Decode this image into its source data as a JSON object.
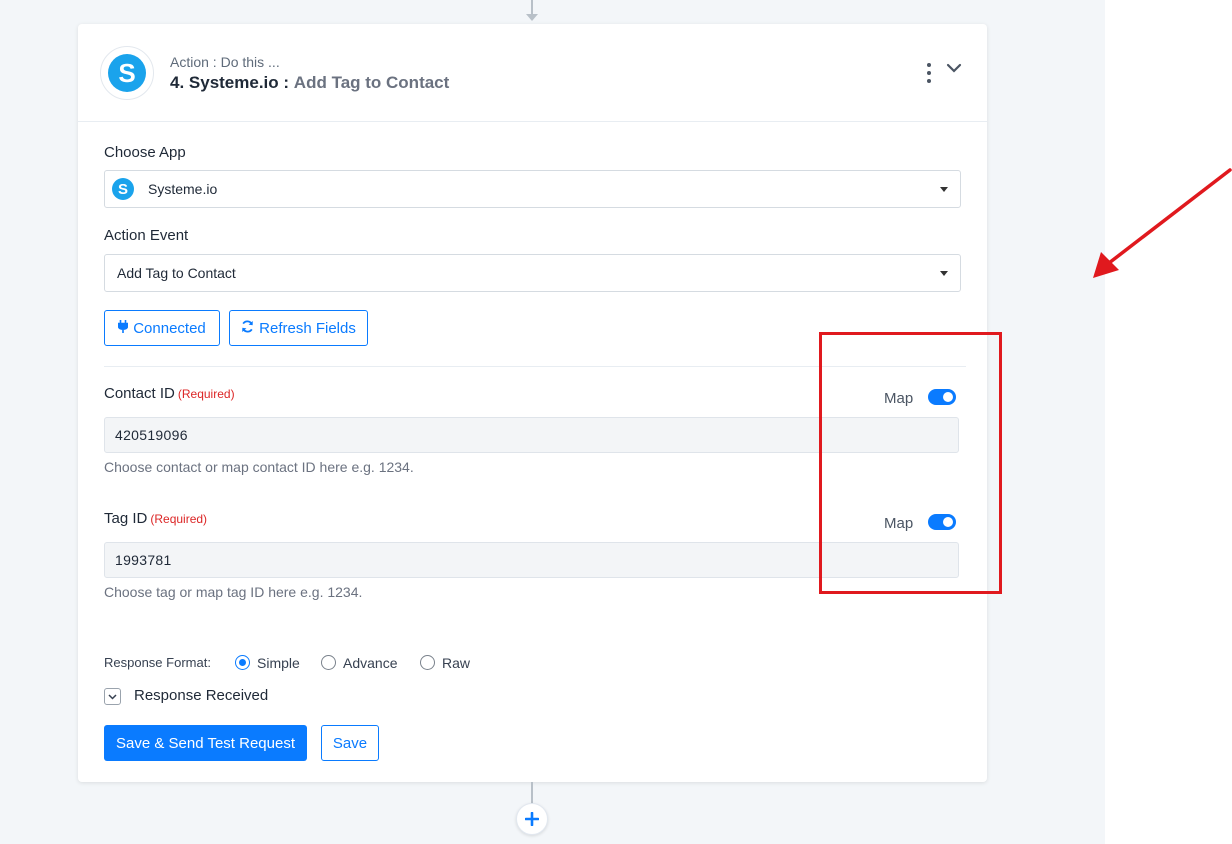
{
  "step": {
    "kicker": "Action : Do this ...",
    "number_app": "4. Systeme.io :",
    "event": "Add Tag to Contact",
    "logo_letter": "S"
  },
  "choose_app": {
    "label": "Choose App",
    "value": "Systeme.io"
  },
  "action_event": {
    "label": "Action Event",
    "value": "Add Tag to Contact"
  },
  "buttons": {
    "connected": "Connected",
    "refresh": "Refresh Fields",
    "save_send": "Save & Send Test Request",
    "save": "Save"
  },
  "fields": {
    "contact_id": {
      "label": "Contact ID",
      "required": "(Required)",
      "map_label": "Map",
      "map_on": true,
      "value": "420519096",
      "help": "Choose contact or map contact ID here e.g. 1234."
    },
    "tag_id": {
      "label": "Tag ID",
      "required": "(Required)",
      "map_label": "Map",
      "map_on": true,
      "value": "1993781",
      "help": "Choose tag or map tag ID here e.g. 1234."
    }
  },
  "response_format": {
    "label": "Response Format:",
    "options": [
      "Simple",
      "Advance",
      "Raw"
    ],
    "selected": "Simple"
  },
  "response_received": "Response Received",
  "colors": {
    "accent": "#0a7bff",
    "app_brand": "#1aa3ec",
    "annotation": "#e0191e"
  }
}
